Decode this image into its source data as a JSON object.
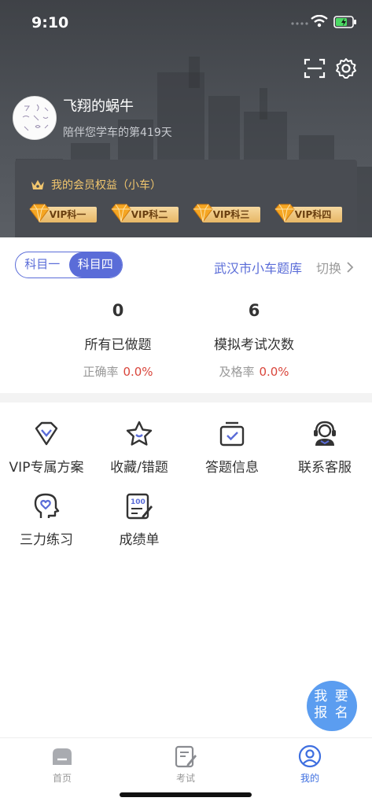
{
  "status": {
    "time": "9:10"
  },
  "profile": {
    "name": "飞翔的蜗牛",
    "subtitle": "陪伴您学车的第419天"
  },
  "vip": {
    "title": "我的会员权益（小车）",
    "badges": [
      "VIP科一",
      "VIP科二",
      "VIP科三",
      "VIP科四"
    ]
  },
  "subject_toggle": {
    "options": [
      "科目一",
      "科目四"
    ],
    "selected": "科目四"
  },
  "question_bank": {
    "name": "武汉市小车题库",
    "switch_label": "切换"
  },
  "stats": [
    {
      "value": "0",
      "label": "所有已做题",
      "rate_label": "正确率",
      "rate_value": "0.0%"
    },
    {
      "value": "6",
      "label": "模拟考试次数",
      "rate_label": "及格率",
      "rate_value": "0.0%"
    }
  ],
  "features": [
    {
      "label": "VIP专属方案",
      "icon": "vip-diamond-icon"
    },
    {
      "label": "收藏/错题",
      "icon": "star-icon"
    },
    {
      "label": "答题信息",
      "icon": "check-calendar-icon"
    },
    {
      "label": "联系客服",
      "icon": "headset-icon"
    },
    {
      "label": "三力练习",
      "icon": "head-heart-icon"
    },
    {
      "label": "成绩单",
      "icon": "score-sheet-icon"
    }
  ],
  "fab": {
    "line1": "我 要",
    "line2": "报 名"
  },
  "tabs": [
    {
      "label": "首页",
      "icon": "home-icon"
    },
    {
      "label": "考试",
      "icon": "exam-icon"
    },
    {
      "label": "我的",
      "icon": "profile-icon",
      "active": true
    }
  ],
  "colors": {
    "accent": "#5a6cd8",
    "gold": "#f1c66e",
    "red": "#d9463c",
    "fab": "#5b9df0"
  }
}
